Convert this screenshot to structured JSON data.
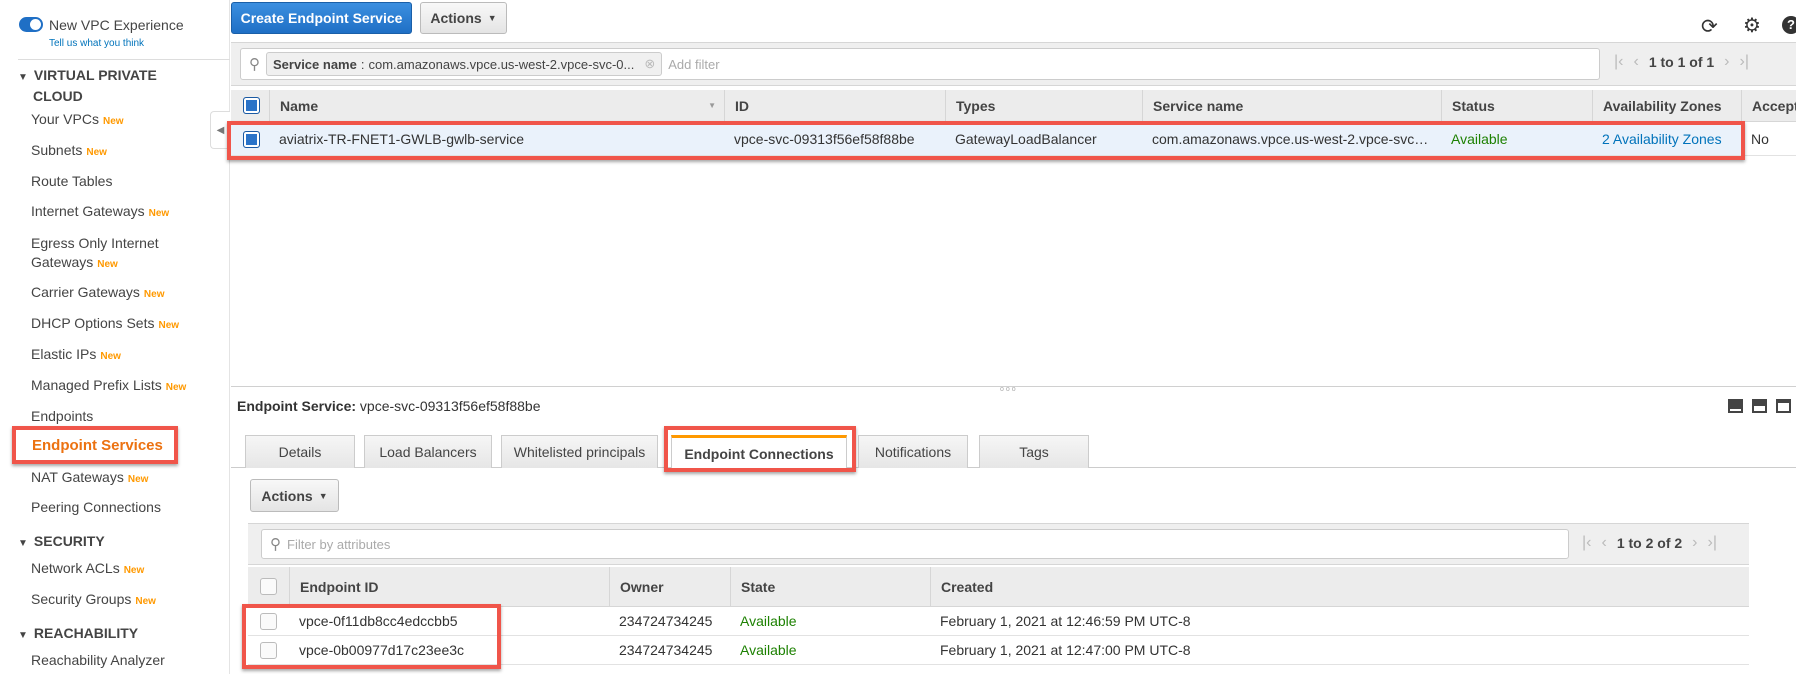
{
  "sidebar": {
    "toggle_label": "New VPC Experience",
    "feedback_link": "Tell us what you think",
    "new_badge": "New",
    "sections": [
      {
        "title_line1": "VIRTUAL PRIVATE",
        "title_line2": "CLOUD"
      },
      {
        "title": "SECURITY"
      },
      {
        "title": "REACHABILITY"
      }
    ],
    "items": [
      {
        "label": "Your VPCs",
        "new": true
      },
      {
        "label": "Subnets",
        "new": true
      },
      {
        "label": "Route Tables",
        "new": false
      },
      {
        "label": "Internet Gateways",
        "new": true
      },
      {
        "label_line1": "Egress Only Internet",
        "label_line2": "Gateways",
        "new": true
      },
      {
        "label": "Carrier Gateways",
        "new": true
      },
      {
        "label": "DHCP Options Sets",
        "new": true
      },
      {
        "label": "Elastic IPs",
        "new": true
      },
      {
        "label": "Managed Prefix Lists",
        "new": true
      },
      {
        "label": "Endpoints",
        "new": false
      },
      {
        "label": "Endpoint Services",
        "new": false,
        "active": true
      },
      {
        "label": "NAT Gateways",
        "new": true
      },
      {
        "label": "Peering Connections",
        "new": false
      },
      {
        "label": "Network ACLs",
        "new": true
      },
      {
        "label": "Security Groups",
        "new": true
      },
      {
        "label": "Reachability Analyzer",
        "new": false
      }
    ]
  },
  "toolbar": {
    "create_label": "Create Endpoint Service",
    "actions_label": "Actions",
    "icons": [
      "refresh-icon",
      "gear-icon",
      "help-icon"
    ]
  },
  "filter": {
    "token_key": "Service name",
    "token_value": "com.amazonaws.vpce.us-west-2.vpce-svc-0...",
    "placeholder": "Add filter",
    "pager": "1 to 1 of 1"
  },
  "services_table": {
    "columns": [
      "Name",
      "ID",
      "Types",
      "Service name",
      "Status",
      "Availability Zones",
      "Accept"
    ],
    "rows": [
      {
        "name": "aviatrix-TR-FNET1-GWLB-gwlb-service",
        "id": "vpce-svc-09313f56ef58f88be",
        "types": "GatewayLoadBalancer",
        "service_name": "com.amazonaws.vpce.us-west-2.vpce-svc…",
        "status": "Available",
        "azs": "2 Availability Zones",
        "accept": "No",
        "selected": true
      }
    ]
  },
  "detail": {
    "label": "Endpoint Service:",
    "value": "vpce-svc-09313f56ef58f88be",
    "tabs": [
      "Details",
      "Load Balancers",
      "Whitelisted principals",
      "Endpoint Connections",
      "Notifications",
      "Tags"
    ],
    "active_tab": "Endpoint Connections",
    "actions_label": "Actions",
    "filter_placeholder": "Filter by attributes",
    "pager": "1 to 2 of 2",
    "columns": [
      "Endpoint ID",
      "Owner",
      "State",
      "Created"
    ],
    "rows": [
      {
        "endpoint_id": "vpce-0f11db8cc4edccbb5",
        "owner": "234724734245",
        "state": "Available",
        "created": "February 1, 2021 at 12:46:59 PM UTC-8"
      },
      {
        "endpoint_id": "vpce-0b00977d17c23ee3c",
        "owner": "234724734245",
        "state": "Available",
        "created": "February 1, 2021 at 12:47:00 PM UTC-8"
      }
    ]
  },
  "colors": {
    "accent": "#f90",
    "primary": "#1f6fc5",
    "available": "#1d8102",
    "link": "#0073bb",
    "highlight": "#f0554a"
  }
}
